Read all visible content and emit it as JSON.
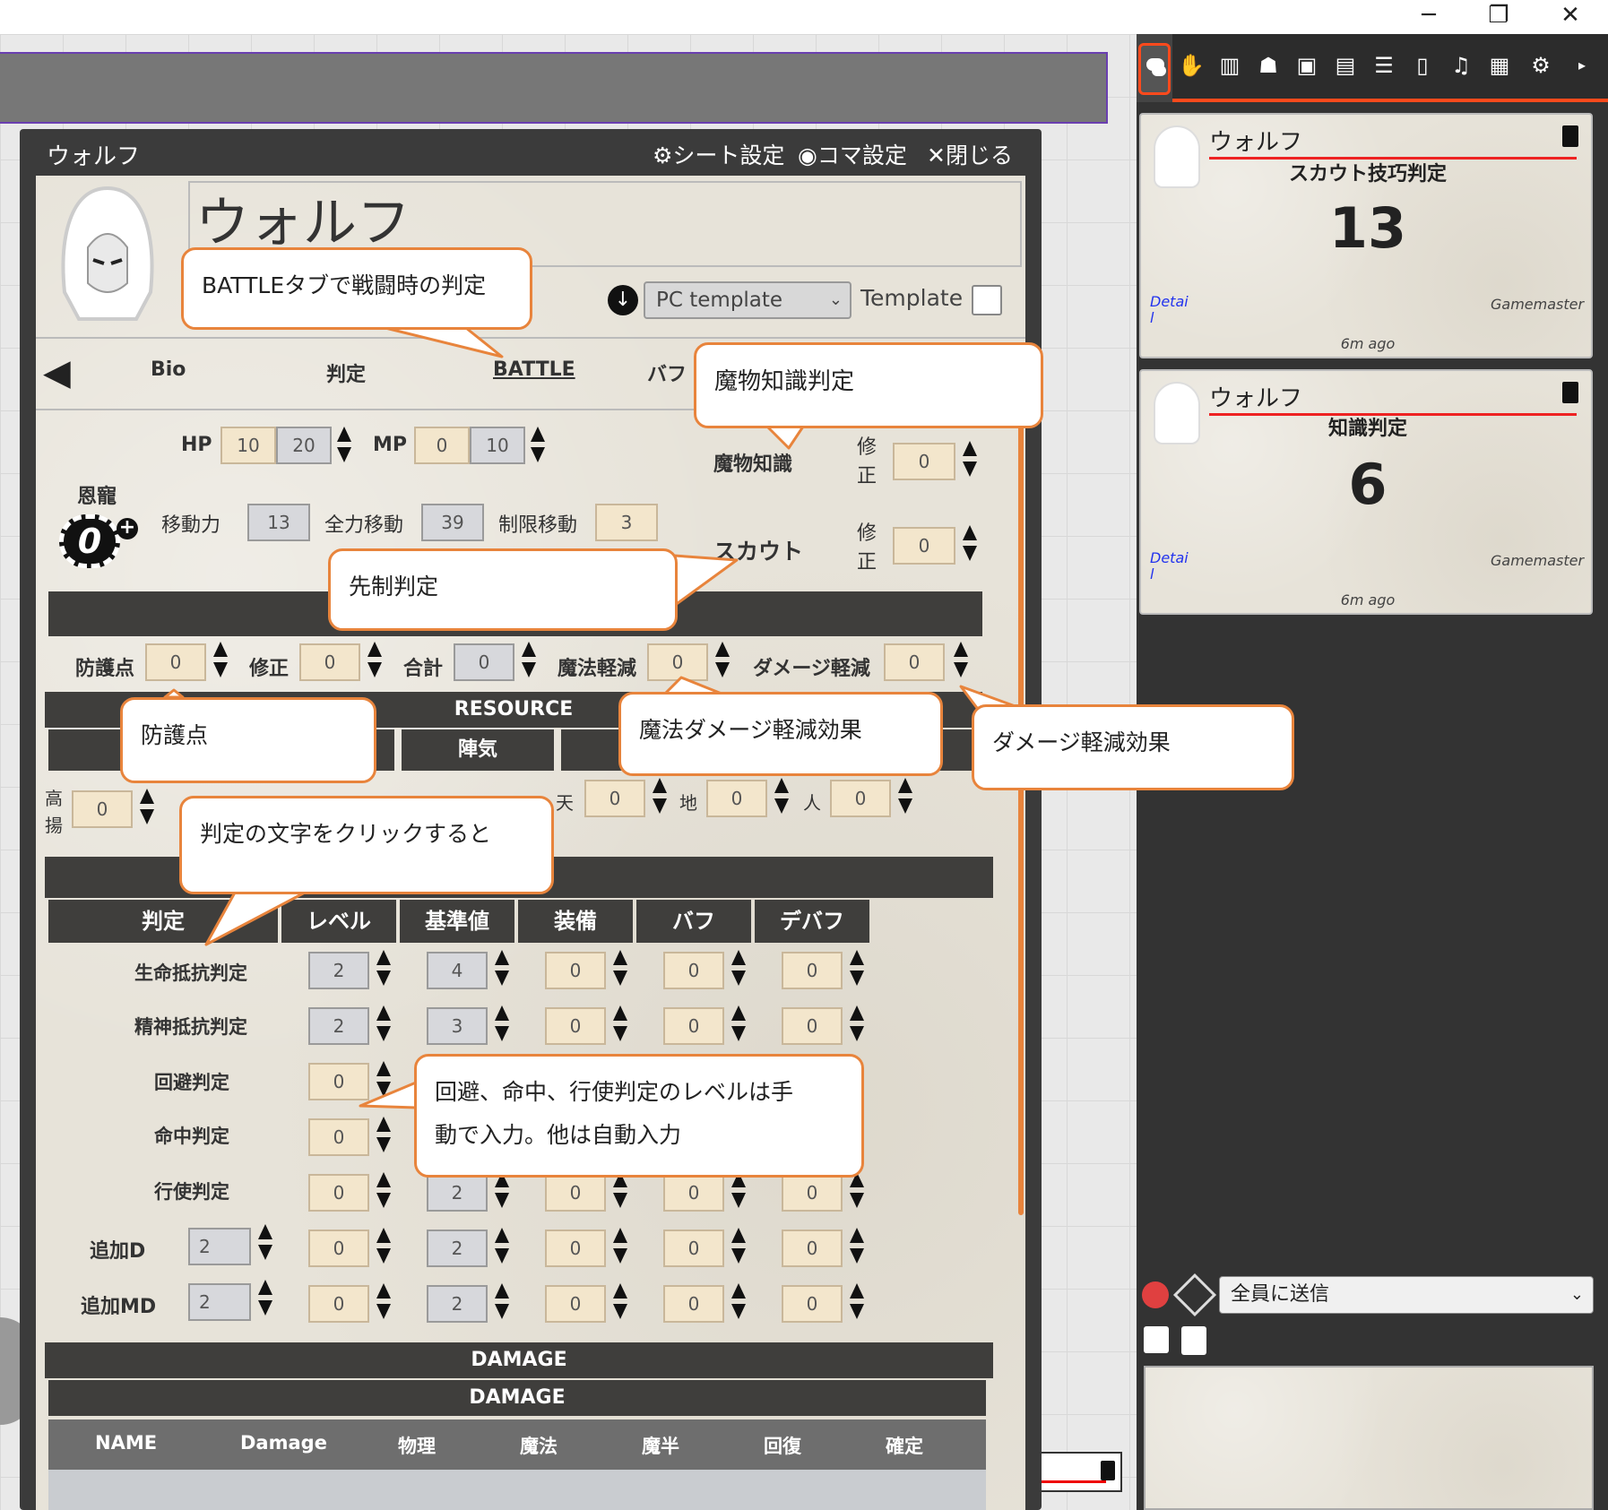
{
  "window_controls": {
    "minimize": "─",
    "restore": "❐",
    "close": "✕"
  },
  "sheet": {
    "window_title": "ウォルフ",
    "header_actions": {
      "sheet_settings": "シート設定",
      "token_settings": "コマ設定",
      "close": "閉じる"
    },
    "character_name": "ウォルフ",
    "template_select": "PC template",
    "template_label": "Template",
    "tabs": {
      "prev_icon": "◀",
      "bio": "Bio",
      "judge": "判定",
      "battle": "BATTLE",
      "buff": "バフ"
    },
    "hp": {
      "label": "HP",
      "current": "10",
      "max": "20"
    },
    "mp": {
      "label": "MP",
      "current": "0",
      "max": "10"
    },
    "blessing": {
      "label": "恩寵",
      "value": "0",
      "plus": "+"
    },
    "movement": {
      "move_label": "移動力",
      "move": "13",
      "full_label": "全力移動",
      "full": "39",
      "limited_label": "制限移動",
      "limited": "3"
    },
    "monster_knowledge": {
      "label": "魔物知識",
      "mod_label": "修正",
      "value": "0"
    },
    "scout": {
      "label": "スカウト",
      "mod_label": "修正",
      "value": "0"
    },
    "defense": {
      "armor_label": "防護点",
      "armor": "0",
      "mod_label": "修正",
      "mod": "0",
      "total_label": "合計",
      "total": "0",
      "magic_reduce_label": "魔法軽減",
      "magic_reduce": "0",
      "damage_reduce_label": "ダメージ軽減",
      "damage_reduce": "0"
    },
    "resource": {
      "title": "RESOURCE",
      "jinki": "陣気",
      "row_label_1": "高揚",
      "row_val_1": "0",
      "ten_label": "天",
      "ten": "0",
      "chi_label": "地",
      "chi": "0",
      "hito_label": "人",
      "hito": "0"
    },
    "checks": {
      "headers": [
        "判定",
        "レベル",
        "基準値",
        "装備",
        "バフ",
        "デバフ"
      ],
      "rows": [
        {
          "name": "生命抵抗判定",
          "level": "2",
          "base": "4",
          "equip": "0",
          "buff": "0",
          "debuff": "0"
        },
        {
          "name": "精神抵抗判定",
          "level": "2",
          "base": "3",
          "equip": "0",
          "buff": "0",
          "debuff": "0"
        },
        {
          "name": "回避判定",
          "level": "0",
          "base": "",
          "equip": "",
          "buff": "",
          "debuff": ""
        },
        {
          "name": "命中判定",
          "level": "0",
          "base": "",
          "equip": "",
          "buff": "",
          "debuff": ""
        },
        {
          "name": "行使判定",
          "level": "0",
          "base": "2",
          "equip": "0",
          "buff": "0",
          "debuff": "0"
        }
      ],
      "extra": [
        {
          "name": "追加D",
          "input": "2",
          "level": "0",
          "base": "2",
          "equip": "0",
          "buff": "0",
          "debuff": "0"
        },
        {
          "name": "追加MD",
          "input": "2",
          "level": "0",
          "base": "2",
          "equip": "0",
          "buff": "0",
          "debuff": "0"
        }
      ]
    },
    "damage": {
      "title1": "DAMAGE",
      "title2": "DAMAGE",
      "headers": [
        "NAME",
        "Damage",
        "物理",
        "魔法",
        "魔半",
        "回復",
        "確定"
      ]
    }
  },
  "callouts": {
    "battle_tab": "BATTLEタブで戦闘時の判定",
    "monster_knowledge": "魔物知識判定",
    "initiative": "先制判定",
    "armor": "防護点",
    "magic_damage": "魔法ダメージ軽減効果",
    "damage_reduce": "ダメージ軽減効果",
    "click_text": "判定の文字をクリックすると",
    "manual_input_line1": "回避、命中、行使判定のレベルは手",
    "manual_input_line2": "動で入力。他は自動入力"
  },
  "chat": {
    "messages": [
      {
        "sender": "ウォルフ",
        "title": "スカウト技巧判定",
        "result": "13",
        "detail": "Detail",
        "who": "Gamemaster",
        "time": "6m ago"
      },
      {
        "sender": "ウォルフ",
        "title": "知識判定",
        "result": "6",
        "detail": "Detail",
        "who": "Gamemaster",
        "time": "6m ago"
      }
    ],
    "send_to": "全員に送信"
  },
  "colors": {
    "accent": "#e8843c",
    "dark_bar": "#3f3e3c",
    "panel": "#2f2f2f",
    "chat_active": "#ff4a1c"
  }
}
